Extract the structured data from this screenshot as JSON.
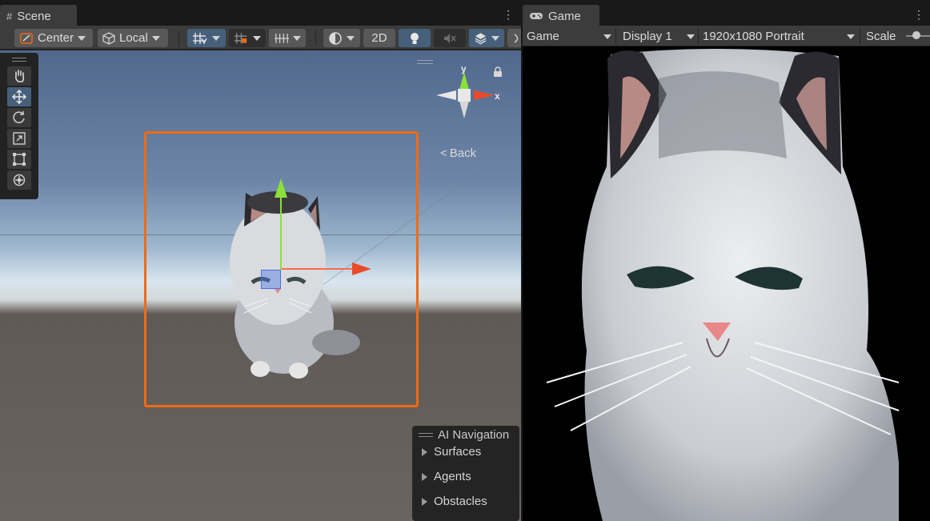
{
  "scene": {
    "tab_title": "Scene",
    "toolbar": {
      "pivot_label": "Center",
      "space_label": "Local",
      "mode_2d_label": "2D"
    },
    "gizmo": {
      "y_label": "y",
      "x_label": "x",
      "back_label": "Back"
    },
    "ai_navigation": {
      "title": "AI Navigation",
      "items": [
        {
          "label": "Surfaces"
        },
        {
          "label": "Agents"
        },
        {
          "label": "Obstacles"
        }
      ]
    }
  },
  "game": {
    "tab_title": "Game",
    "toolbar": {
      "view_label": "Game",
      "display_label": "Display 1",
      "resolution_label": "1920x1080 Portrait",
      "scale_label": "Scale"
    }
  },
  "colors": {
    "selection_outline": "#f26a13",
    "y_axis": "#8be03a",
    "x_axis": "#ea4a2a",
    "active_button": "#46607c"
  }
}
